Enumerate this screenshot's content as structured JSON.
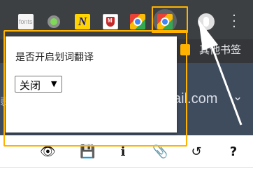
{
  "toolbar": {
    "extensions": [
      {
        "name": "fonts-extension-icon",
        "label": "fonts"
      },
      {
        "name": "circle-extension-icon"
      },
      {
        "name": "n-extension-icon",
        "label": "N"
      },
      {
        "name": "shield-extension-icon"
      },
      {
        "name": "translate-extension-icon"
      },
      {
        "name": "translate-extension-icon-active"
      }
    ],
    "highlight_color": "#ffb300"
  },
  "bookmarks": {
    "other_label": "其他书签"
  },
  "page": {
    "email_fragment": "ail.com",
    "left_fragment": "翡"
  },
  "popup": {
    "question": "是否开启划词翻译",
    "select_value": "关闭",
    "select_arrow": "▼"
  },
  "actions": [
    {
      "name": "eye-icon",
      "glyph": "👁"
    },
    {
      "name": "save-icon",
      "glyph": "💾"
    },
    {
      "name": "info-icon",
      "glyph": "i"
    },
    {
      "name": "attachment-icon",
      "glyph": "📎"
    },
    {
      "name": "history-icon",
      "glyph": "↺"
    },
    {
      "name": "help-icon",
      "glyph": "?"
    }
  ],
  "colors": {
    "toolbar": "#3c4043",
    "header": "#3f4c5e",
    "outline": "#ffb300"
  }
}
